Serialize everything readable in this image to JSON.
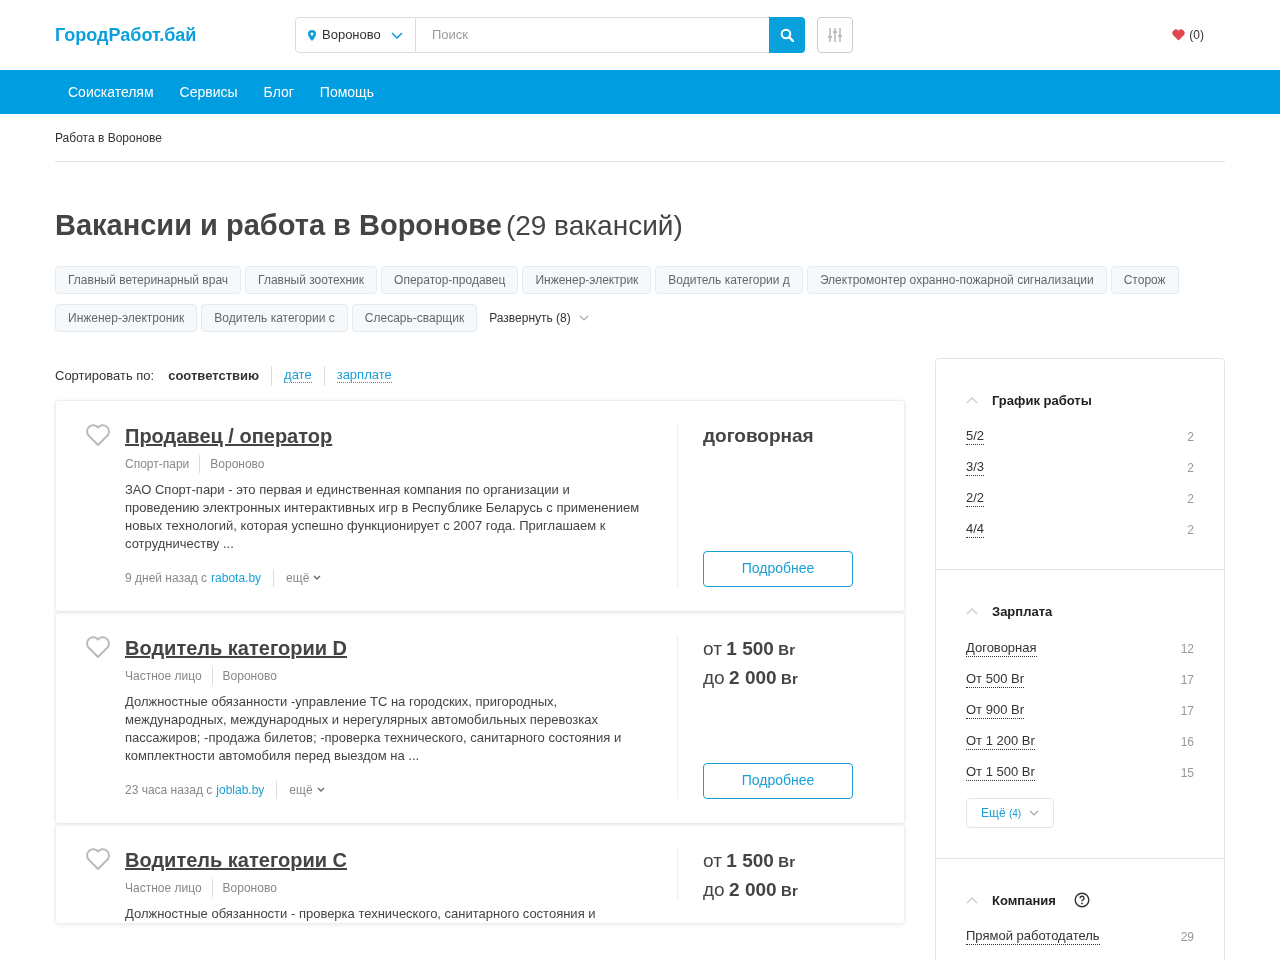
{
  "header": {
    "logo": "ГородРабот.бай",
    "location": "Вороново",
    "search_placeholder": "Поиск",
    "favorites": "(0)"
  },
  "nav": [
    "Соискателям",
    "Сервисы",
    "Блог",
    "Помощь"
  ],
  "breadcrumb": "Работа в Воронове",
  "heading": {
    "title": "Вакансии и работа в Воронове",
    "count": "(29 вакансий)"
  },
  "tags": [
    "Главный ветеринарный врач",
    "Главный зоотехник",
    "Оператор-продавец",
    "Инженер-электрик",
    "Водитель категории д",
    "Электромонтер охранно-пожарной сигнализации",
    "Сторож",
    "Инженер-электроник",
    "Водитель категории с",
    "Слесарь-сварщик"
  ],
  "expand": "Развернуть (8)",
  "sort": {
    "label": "Сортировать по:",
    "options": [
      {
        "label": "соответствию",
        "selected": true
      },
      {
        "label": "дате",
        "selected": false
      },
      {
        "label": "зарплате",
        "selected": false
      }
    ]
  },
  "vacancies": [
    {
      "title": "Продавец / оператор",
      "company": "Спорт-пари",
      "city": "Вороново",
      "description": "ЗАО Спорт-пари - это первая и единственная компания по организации и проведению электронных интерактивных игр в Республике Беларусь с применением новых технологий, которая успешно функционирует с 2007 года. Приглашаем к сотрудничеству ...",
      "posted": "9 дней назад с",
      "source": "rabota.by",
      "more": "ещё",
      "salary": {
        "kind": "negotiable",
        "text": "договорная"
      },
      "button": "Подробнее"
    },
    {
      "title": "Водитель категории D",
      "company": "Частное лицо",
      "city": "Вороново",
      "description": "Должностные обязанности -управление ТС на городских, пригородных, международных, международных и нерегулярных автомобильных перевозках пассажиров; -продажа билетов; -проверка технического, санитарного состояния и комплектности автомобиля перед выездом на ...",
      "posted": "23 часа назад с",
      "source": "joblab.by",
      "more": "ещё",
      "salary": {
        "kind": "range",
        "lines": [
          {
            "label": "от",
            "amount": "1 500",
            "currency": "Br"
          },
          {
            "label": "до",
            "amount": "2 000",
            "currency": "Br"
          }
        ]
      },
      "button": "Подробнее"
    },
    {
      "title": "Водитель категории С",
      "company": "Частное лицо",
      "city": "Вороново",
      "description": "Должностные обязанности - проверка технического, санитарного состояния и",
      "salary": {
        "kind": "range",
        "lines": [
          {
            "label": "от",
            "amount": "1 500",
            "currency": "Br"
          },
          {
            "label": "до",
            "amount": "2 000",
            "currency": "Br"
          }
        ]
      }
    }
  ],
  "filters": [
    {
      "title": "График работы",
      "expanded": true,
      "help": false,
      "items": [
        {
          "label": "5/2",
          "count": "2"
        },
        {
          "label": "3/3",
          "count": "2"
        },
        {
          "label": "2/2",
          "count": "2"
        },
        {
          "label": "4/4",
          "count": "2"
        }
      ]
    },
    {
      "title": "Зарплата",
      "expanded": true,
      "help": false,
      "items": [
        {
          "label": "Договорная",
          "count": "12"
        },
        {
          "label": "От 500 Br",
          "count": "17"
        },
        {
          "label": "От 900 Br",
          "count": "17"
        },
        {
          "label": "От 1 200 Br",
          "count": "16"
        },
        {
          "label": "От 1 500 Br",
          "count": "15"
        }
      ],
      "more": {
        "label": "Ещё",
        "count": "(4)"
      }
    },
    {
      "title": "Компания",
      "expanded": true,
      "help": true,
      "items": [
        {
          "label": "Прямой работодатель",
          "count": "29"
        }
      ]
    }
  ]
}
